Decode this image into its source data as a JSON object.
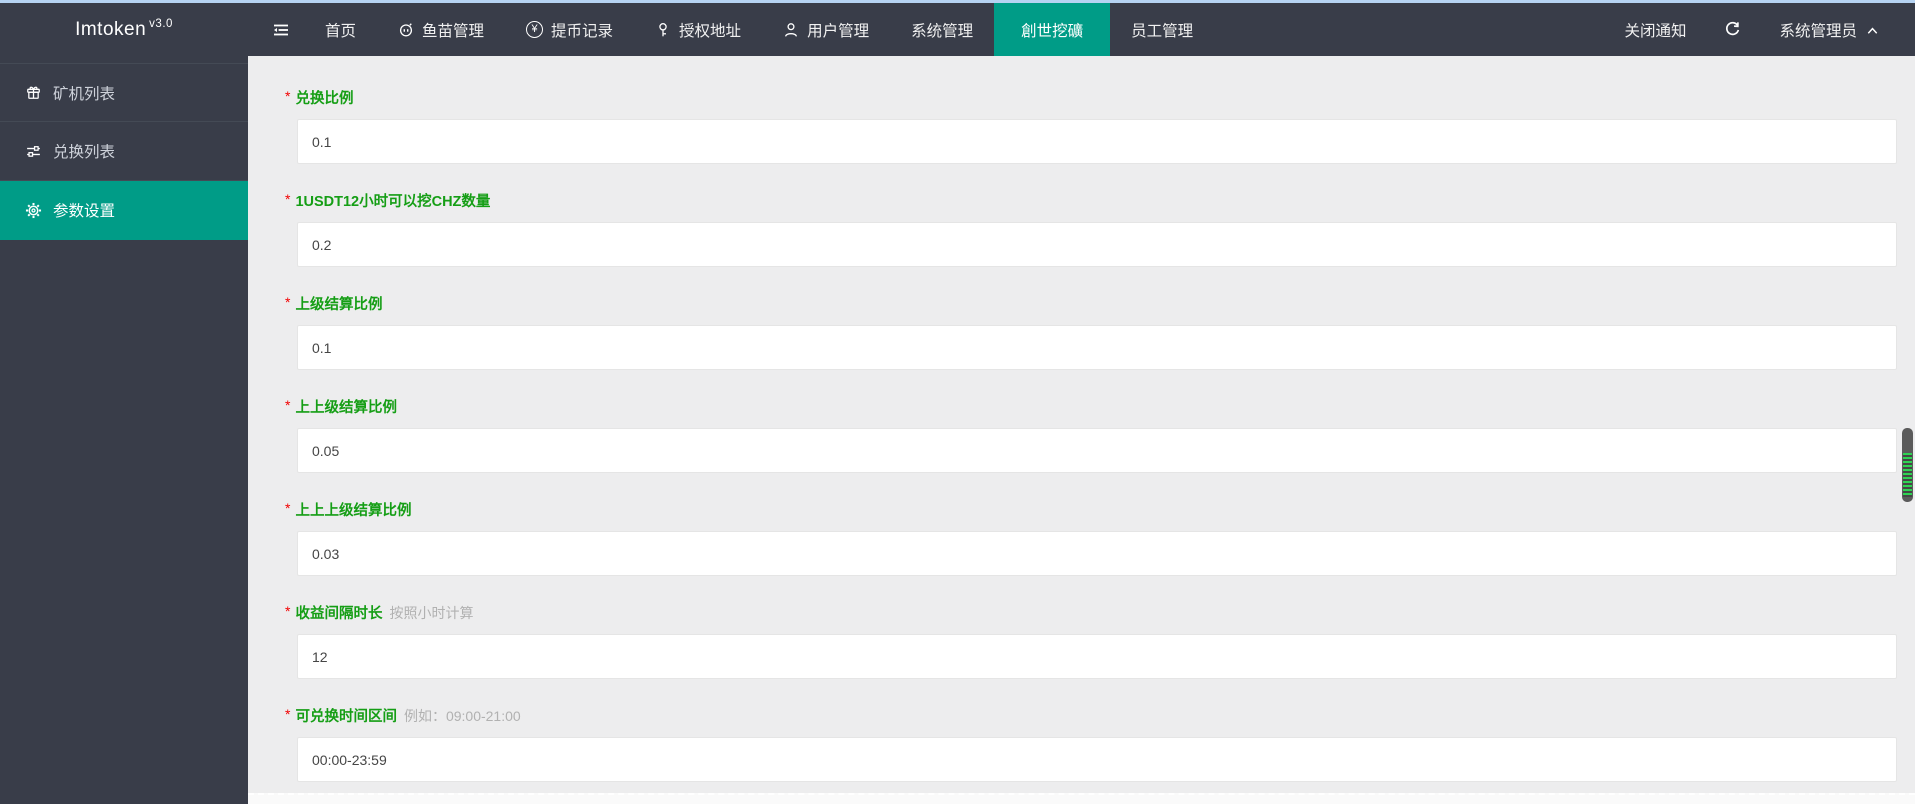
{
  "brand": {
    "name": "Imtoken",
    "version": "v3.0"
  },
  "navbar": {
    "items": [
      {
        "label": "首页"
      },
      {
        "label": "鱼苗管理"
      },
      {
        "label": "提币记录"
      },
      {
        "label": "授权地址"
      },
      {
        "label": "用户管理"
      },
      {
        "label": "系统管理"
      },
      {
        "label": "創世挖礦",
        "active": true
      },
      {
        "label": "员工管理"
      }
    ],
    "close_notice": "关闭通知",
    "admin_name": "系统管理员"
  },
  "sidebar": {
    "items": [
      {
        "label": "矿机列表",
        "icon": "gift-icon",
        "active": false
      },
      {
        "label": "兑换列表",
        "icon": "sliders-icon",
        "active": false
      },
      {
        "label": "参数设置",
        "icon": "gear-icon",
        "active": true
      }
    ]
  },
  "form": {
    "required_marker": "*",
    "fields": [
      {
        "label": "兑换比例",
        "hint": "",
        "value": "0.1",
        "required": true
      },
      {
        "label": "1USDT12小时可以挖CHZ数量",
        "hint": "",
        "value": "0.2",
        "required": true
      },
      {
        "label": "上级结算比例",
        "hint": "",
        "value": "0.1",
        "required": true
      },
      {
        "label": "上上级结算比例",
        "hint": "",
        "value": "0.05",
        "required": true
      },
      {
        "label": "上上上级结算比例",
        "hint": "",
        "value": "0.03",
        "required": true
      },
      {
        "label": "收益间隔时长",
        "hint": "按照小时计算",
        "value": "12",
        "required": true
      },
      {
        "label": "可兑换时间区间",
        "hint": "例如：09:00-21:00",
        "value": "00:00-23:59",
        "required": true
      }
    ]
  },
  "icons": {
    "yen": "¥"
  },
  "colors": {
    "top_strip": "#b6d3f2",
    "header_bg": "#393d49",
    "accent_teal": "#009c87",
    "content_bg": "#ededee",
    "label_green": "#159e15",
    "required_red": "#f20000",
    "hint_gray": "#b1b1b1",
    "input_border": "#e5e5e5",
    "scrollbar_green": "#2ed352"
  }
}
